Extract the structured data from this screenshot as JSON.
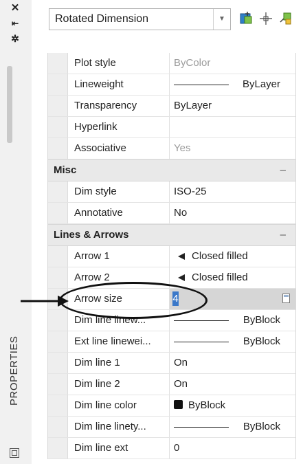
{
  "window": {
    "title": "PROPERTIES",
    "close_icon": "close-icon",
    "autohide_icon": "autohide-icon",
    "properties_icon": "properties-icon"
  },
  "selector": {
    "value": "Rotated Dimension",
    "toggle_pickadd_icon": "toggle-pickadd-icon",
    "select_objects_icon": "select-objects-icon",
    "quick_select_icon": "quick-select-icon"
  },
  "general_rows": [
    {
      "label": "Plot style",
      "value": "ByColor",
      "gray": true
    },
    {
      "label": "Lineweight",
      "value": "ByLayer",
      "line": true
    },
    {
      "label": "Transparency",
      "value": "ByLayer"
    },
    {
      "label": "Hyperlink",
      "value": ""
    },
    {
      "label": "Associative",
      "value": "Yes",
      "gray": true
    }
  ],
  "misc": {
    "title": "Misc",
    "collapse": "–",
    "rows": [
      {
        "label": "Dim style",
        "value": "ISO-25"
      },
      {
        "label": "Annotative",
        "value": "No"
      }
    ]
  },
  "lines_arrows": {
    "title": "Lines & Arrows",
    "collapse": "–",
    "rows": [
      {
        "label": "Arrow 1",
        "value": "Closed filled"
      },
      {
        "label": "Arrow 2",
        "value": "Closed filled"
      },
      {
        "label": "Arrow size",
        "value": "4"
      },
      {
        "label": "Dim line linew...",
        "value": "ByBlock"
      },
      {
        "label": "Ext line linewei...",
        "value": "ByBlock"
      },
      {
        "label": "Dim line 1",
        "value": "On"
      },
      {
        "label": "Dim line 2",
        "value": "On"
      },
      {
        "label": "Dim line color",
        "value": "ByBlock"
      },
      {
        "label": "Dim line linety...",
        "value": "ByBlock"
      },
      {
        "label": "Dim line ext",
        "value": "0"
      }
    ]
  },
  "colors": {
    "selection": "#3a78c9",
    "section_bg": "#e9e9e9"
  }
}
